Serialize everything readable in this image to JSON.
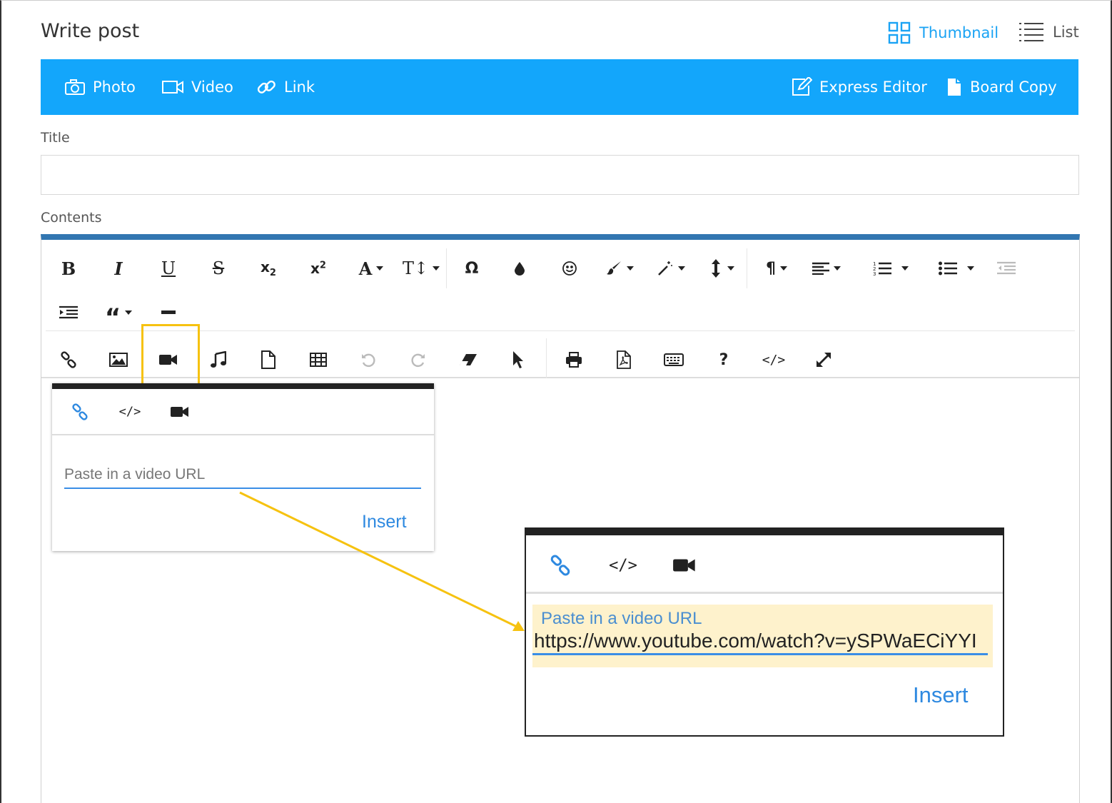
{
  "header": {
    "title": "Write post",
    "view_thumbnail": "Thumbnail",
    "view_list": "List"
  },
  "bar": {
    "photo": "Photo",
    "video": "Video",
    "link": "Link",
    "express_editor": "Express Editor",
    "board_copy": "Board Copy",
    "color": "#13a6fb"
  },
  "form": {
    "title_label": "Title",
    "title_value": "",
    "contents_label": "Contents"
  },
  "toolbar": {
    "row1": [
      "bold-icon",
      "italic-icon",
      "underline-icon",
      "strikethrough-icon",
      "subscript-icon",
      "superscript-icon",
      "font-family-icon",
      "font-size-icon",
      "special-char-icon",
      "color-drop-icon",
      "emoji-icon",
      "paint-brush-icon",
      "magic-wand-icon",
      "line-height-icon",
      "paragraph-icon",
      "align-icon",
      "ordered-list-icon",
      "unordered-list-icon",
      "outdent-icon"
    ],
    "row2": [
      "indent-icon",
      "blockquote-icon",
      "horizontal-rule-icon"
    ],
    "row3": [
      "link-icon",
      "image-icon",
      "video-icon",
      "audio-icon",
      "file-icon",
      "table-icon",
      "undo-icon",
      "redo-icon",
      "eraser-icon",
      "select-pointer-icon",
      "print-icon",
      "pdf-icon",
      "keyboard-icon",
      "help-icon",
      "code-view-icon",
      "fullscreen-icon"
    ]
  },
  "video_popup": {
    "placeholder": "Paste in a video URL",
    "insert": "Insert",
    "tabs": [
      "link-icon",
      "embed-code-icon",
      "video-camera-icon"
    ]
  },
  "zoom_popup": {
    "label": "Paste in a video URL",
    "url_value": "https://www.youtube.com/watch?v=ySPWaECiYYI",
    "insert": "Insert"
  },
  "colors": {
    "accent": "#13a6fb",
    "highlight": "#f6c210",
    "editor_border": "#3276b1",
    "link": "#2e89e0"
  }
}
